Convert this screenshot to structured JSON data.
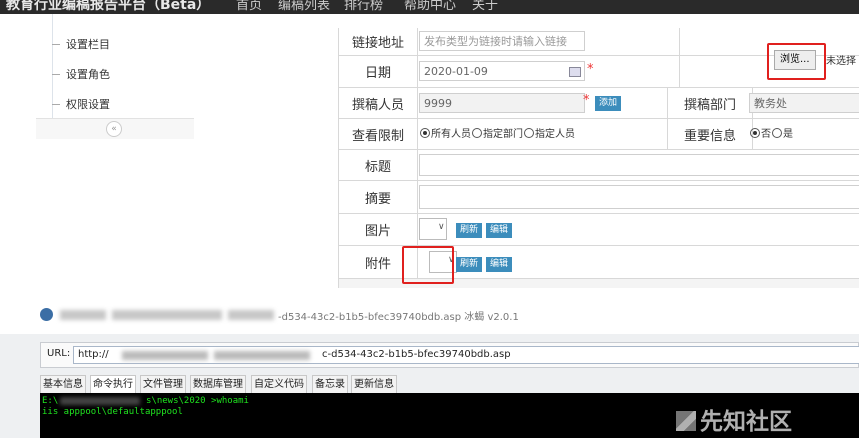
{
  "topbar": {
    "brand": "教育行业编稿报告平台（Beta）",
    "nav": [
      "首页",
      "编稿列表",
      "排行榜",
      "帮助中心",
      "关于"
    ]
  },
  "sidebar": {
    "items": [
      {
        "label": "设置栏目"
      },
      {
        "label": "设置角色"
      },
      {
        "label": "权限设置"
      }
    ],
    "collapse_glyph": "«"
  },
  "form": {
    "link": {
      "label": "链接地址",
      "placeholder": "发布类型为链接时请输入链接"
    },
    "date": {
      "label": "日期",
      "value": "2020-01-09"
    },
    "browse": {
      "button": "浏览...",
      "status": "未选择"
    },
    "author": {
      "label": "撰稿人员",
      "value": "9999",
      "add_button": "添加"
    },
    "dept": {
      "label": "撰稿部门",
      "value": "教务处"
    },
    "view_limit": {
      "label": "查看限制",
      "options": [
        "所有人员",
        "指定部门",
        "指定人员"
      ],
      "selected": "所有人员"
    },
    "important": {
      "label": "重要信息",
      "options": [
        "否",
        "是"
      ],
      "selected": "否"
    },
    "title": {
      "label": "标题"
    },
    "summary": {
      "label": "摘要"
    },
    "image": {
      "label": "图片",
      "refresh": "刷新",
      "edit": "编辑"
    },
    "attachment": {
      "label": "附件",
      "refresh": "刷新",
      "edit": "编辑"
    }
  },
  "shell": {
    "title_suffix": "-d534-43c2-b1b5-bfec39740bdb.asp   冰蝎 v2.0.1",
    "url_label": "URL:",
    "url_prefix": "http://",
    "url_suffix": "c-d534-43c2-b1b5-bfec39740bdb.asp",
    "tabs": [
      "基本信息",
      "命令执行",
      "文件管理",
      "数据库管理",
      "自定义代码",
      "备忘录",
      "更新信息"
    ],
    "active_tab": "命令执行",
    "terminal": {
      "line1_prefix": "E:\\",
      "line1_suffix": "s\\news\\2020 >whoami",
      "line2": "iis apppool\\defaultapppool"
    },
    "watermark": "先知社区"
  },
  "colors": {
    "highlight_box": "#e0201e",
    "terminal_text": "#1fe41f",
    "button_blue": "#3c8dbc"
  }
}
